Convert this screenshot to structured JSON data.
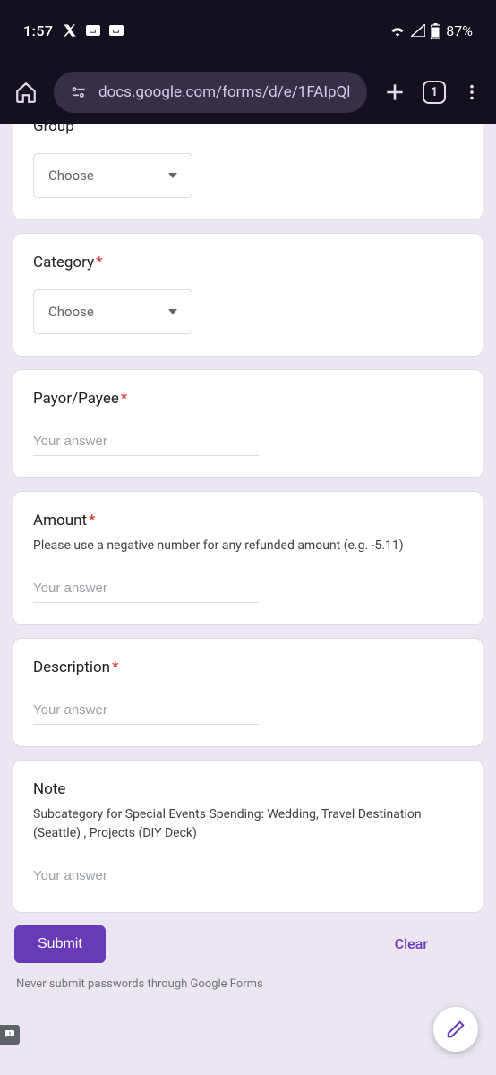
{
  "status": {
    "time": "1:57",
    "battery": "87%"
  },
  "browser": {
    "url": "docs.google.com/forms/d/e/1FAIpQl",
    "tab_count": "1"
  },
  "form": {
    "group": {
      "label": "Group",
      "dropdown": "Choose"
    },
    "category": {
      "label": "Category",
      "dropdown": "Choose"
    },
    "payor": {
      "label": "Payor/Payee",
      "placeholder": "Your answer"
    },
    "amount": {
      "label": "Amount",
      "desc": "Please use a negative number for any refunded amount (e.g. -5.11)",
      "placeholder": "Your answer"
    },
    "description": {
      "label": "Description",
      "placeholder": "Your answer"
    },
    "note": {
      "label": "Note",
      "desc": "Subcategory for Special Events Spending: Wedding, Travel Destination (Seattle) , Projects (DIY Deck)",
      "placeholder": "Your answer"
    },
    "submit": "Submit",
    "clear": "Clear",
    "disclaimer": "Never submit passwords through Google Forms"
  }
}
